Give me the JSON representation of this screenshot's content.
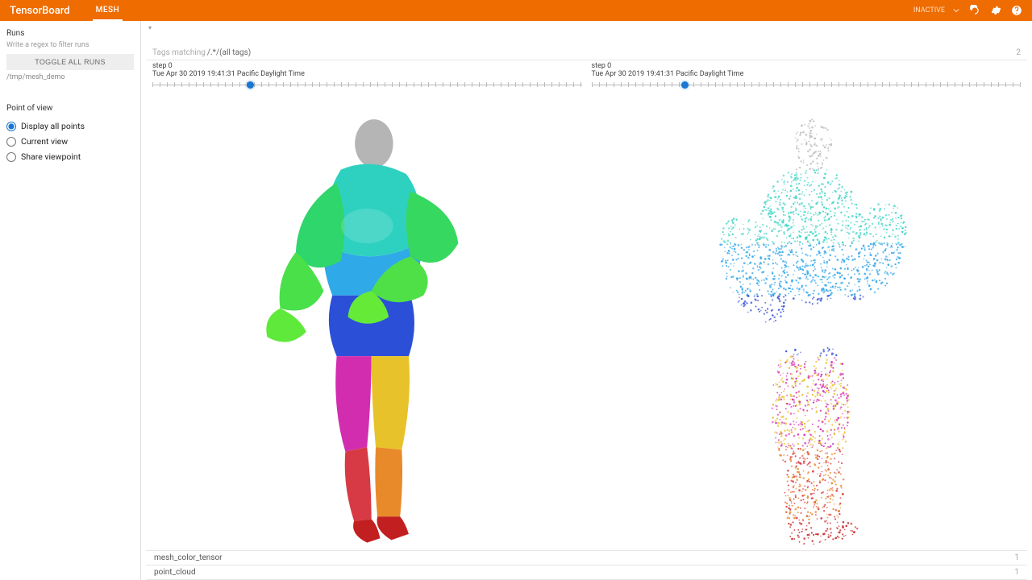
{
  "header": {
    "appTitle": "TensorBoard",
    "activeTab": "MESH",
    "status": "INACTIVE"
  },
  "sidebar": {
    "runsTitle": "Runs",
    "regexHint": "Write a regex to filter runs",
    "toggleAll": "TOGGLE ALL RUNS",
    "runPath": "/tmp/mesh_demo",
    "povTitle": "Point of view",
    "povOptions": [
      {
        "label": "Display all points",
        "value": "all",
        "checked": true
      },
      {
        "label": "Current view",
        "value": "current",
        "checked": false
      },
      {
        "label": "Share viewpoint",
        "value": "share",
        "checked": false
      }
    ]
  },
  "main": {
    "tagsLabel": "Tags matching",
    "tagsFilter": "/.*/(all tags)",
    "tagsMatchCount": "2",
    "panels": [
      {
        "stepLabel": "step",
        "stepValue": "0",
        "timestamp": "Tue Apr 30 2019 19:41:31 Pacific Daylight Time",
        "knobPercent": 22
      },
      {
        "stepLabel": "step",
        "stepValue": "0",
        "timestamp": "Tue Apr 30 2019 19:41:31 Pacific Daylight Time",
        "knobPercent": 21
      }
    ],
    "bottomTags": [
      {
        "name": "mesh_color_tensor",
        "count": "1"
      },
      {
        "name": "point_cloud",
        "count": "1"
      }
    ]
  }
}
